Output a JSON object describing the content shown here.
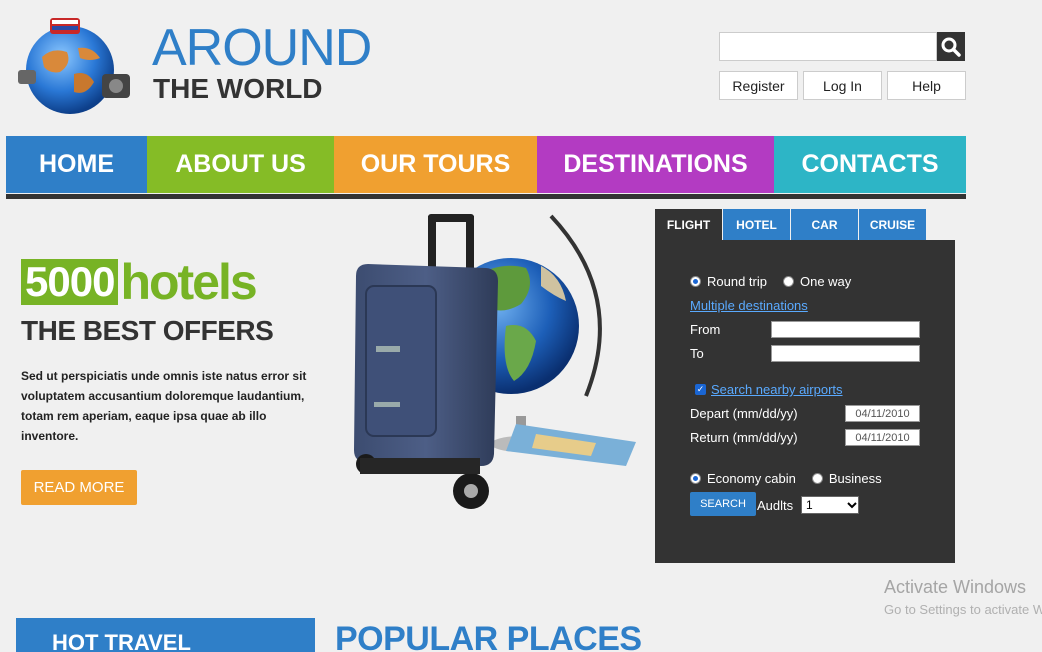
{
  "site": {
    "logo_line1": "AROUND",
    "logo_line2": "THE WORLD"
  },
  "search": {
    "placeholder": "",
    "icon": "search-icon"
  },
  "top_links": {
    "register": "Register",
    "login": "Log In",
    "help": "Help"
  },
  "nav": [
    {
      "label": "HOME",
      "color": "#2f7fc8"
    },
    {
      "label": "ABOUT US",
      "color": "#85bc26"
    },
    {
      "label": "OUR TOURS",
      "color": "#f0a030"
    },
    {
      "label": "DESTINATIONS",
      "color": "#b33bc2"
    },
    {
      "label": "CONTACTS",
      "color": "#2db5c6"
    }
  ],
  "hero": {
    "count": "5000",
    "word": "hotels",
    "subtitle": "THE BEST OFFERS",
    "text": "Sed ut perspiciatis unde omnis iste natus error sit voluptatem accusantium doloremque laudantium, totam rem aperiam, eaque ipsa quae ab illo inventore.",
    "button": "READ MORE"
  },
  "booking": {
    "tabs": [
      "FLIGHT",
      "HOTEL",
      "CAR",
      "CRUISE"
    ],
    "round_trip": "Round trip",
    "one_way": "One way",
    "multiple": "Multiple destinations",
    "from": "From",
    "to": "To",
    "nearby": "Search nearby airports",
    "depart": "Depart (mm/dd/yy)",
    "depart_value": "04/11/2010",
    "return": "Return (mm/dd/yy)",
    "return_value": "04/11/2010",
    "economy": "Economy cabin",
    "business": "Business",
    "search": "SEARCH",
    "adults": "Audlts",
    "adults_value": "1"
  },
  "bottom": {
    "hot_travel": "HOT TRAVEL",
    "popular": "POPULAR PLACES"
  },
  "watermark": {
    "line1": "Activate Windows",
    "line2": "Go to Settings to activate Windows."
  }
}
